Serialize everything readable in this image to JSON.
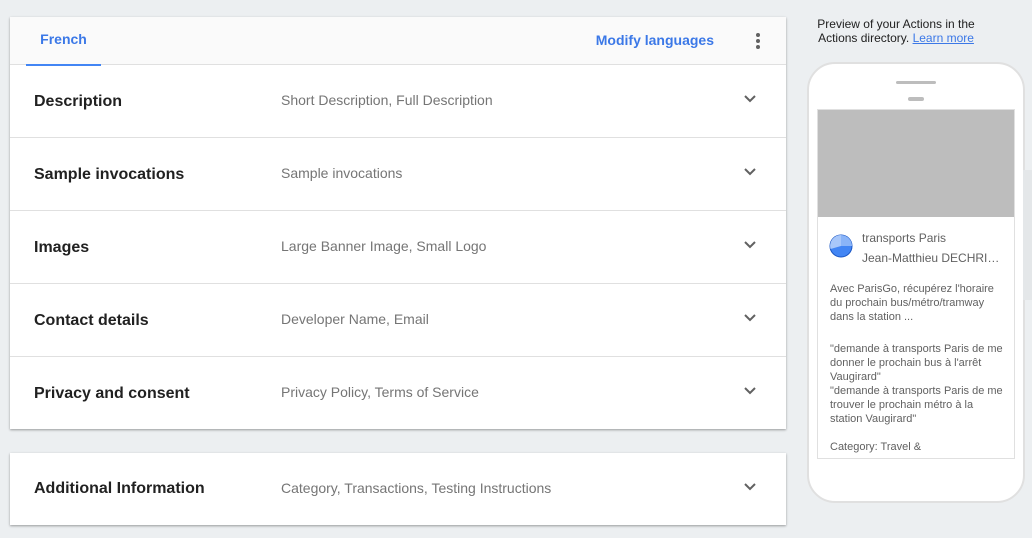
{
  "tabs": [
    {
      "label": "French",
      "active": true
    }
  ],
  "header": {
    "modify_label": "Modify languages",
    "more_icon": "more-vert-icon"
  },
  "sections": [
    {
      "label": "Description",
      "summary": "Short Description, Full Description"
    },
    {
      "label": "Sample invocations",
      "summary": "Sample invocations"
    },
    {
      "label": "Images",
      "summary": "Large Banner Image, Small Logo"
    },
    {
      "label": "Contact details",
      "summary": "Developer Name, Email"
    },
    {
      "label": "Privacy and consent",
      "summary": "Privacy Policy, Terms of Service"
    }
  ],
  "additional": {
    "label": "Additional Information",
    "summary": "Category, Transactions, Testing Instructions"
  },
  "preview": {
    "caption": "Preview of your Actions in the Actions directory.",
    "learn_more": "Learn more",
    "app_name": "transports Paris",
    "developer": "Jean-Matthieu DECHRISTÉ",
    "description": "Avec ParisGo, récupérez l'horaire du prochain bus/métro/tramway dans la station ...",
    "invocations": [
      "\"demande à transports Paris de me donner le prochain bus à l'arrêt Vaugirard\"",
      "\"demande à transports Paris de me trouver le prochain métro à la station Vaugirard\""
    ],
    "category": "Category: Travel &"
  },
  "colors": {
    "accent": "#3b78e7",
    "background": "#eceff1",
    "banner": "#bdbdbd",
    "logo": "#4285f4"
  }
}
